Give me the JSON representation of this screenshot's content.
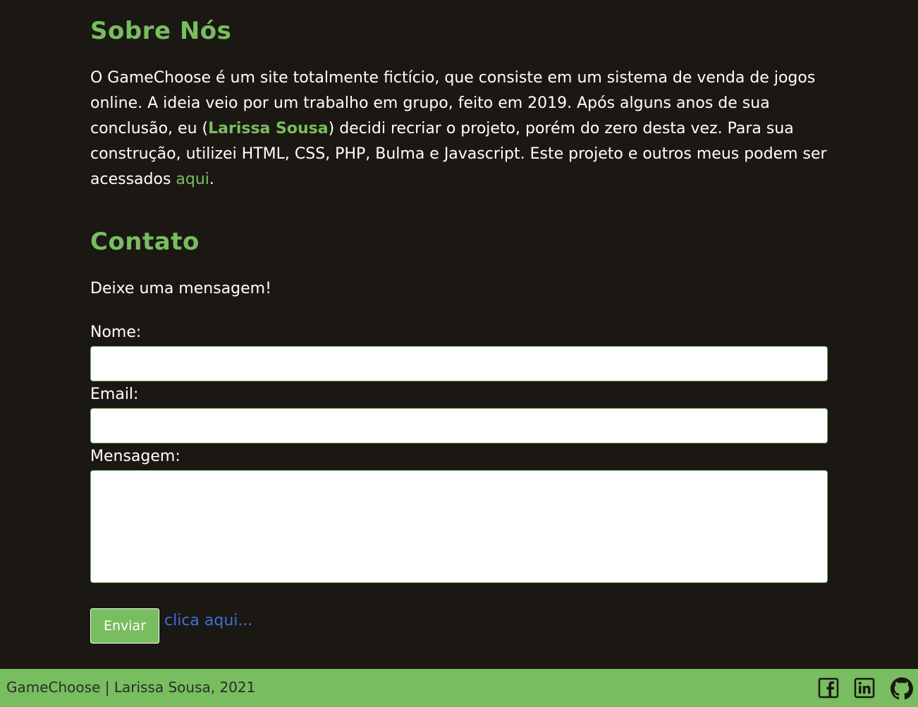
{
  "about": {
    "title": "Sobre Nós",
    "text_part1": "O GameChoose é um site totalmente fictício, que consiste em um sistema de venda de jogos online. A ideia veio por um trabalho em grupo, feito em 2019. Após alguns anos de sua conclusão, eu (",
    "author_link": "Larissa Sousa",
    "text_part2": ") decidi recriar o projeto, porém do zero desta vez. Para sua construção, utilizei HTML, CSS, PHP, Bulma e Javascript. Este projeto e outros meus podem ser acessados ",
    "here_link": "aqui",
    "text_part3": "."
  },
  "contact": {
    "title": "Contato",
    "subtitle": "Deixe uma mensagem!",
    "name_label": "Nome:",
    "name_value": "",
    "email_label": "Email:",
    "email_value": "",
    "message_label": "Mensagem:",
    "message_value": "",
    "submit_label": "Enviar",
    "link_label": "clica aqui..."
  },
  "footer": {
    "text": "GameChoose | Larissa Sousa, 2021",
    "icons": [
      "facebook-icon",
      "linkedin-icon",
      "github-icon"
    ]
  },
  "colors": {
    "background": "#1b1814",
    "accent": "#78bd5f",
    "link_blue": "#3e6fd8",
    "footer_text": "#2b2b2b"
  }
}
